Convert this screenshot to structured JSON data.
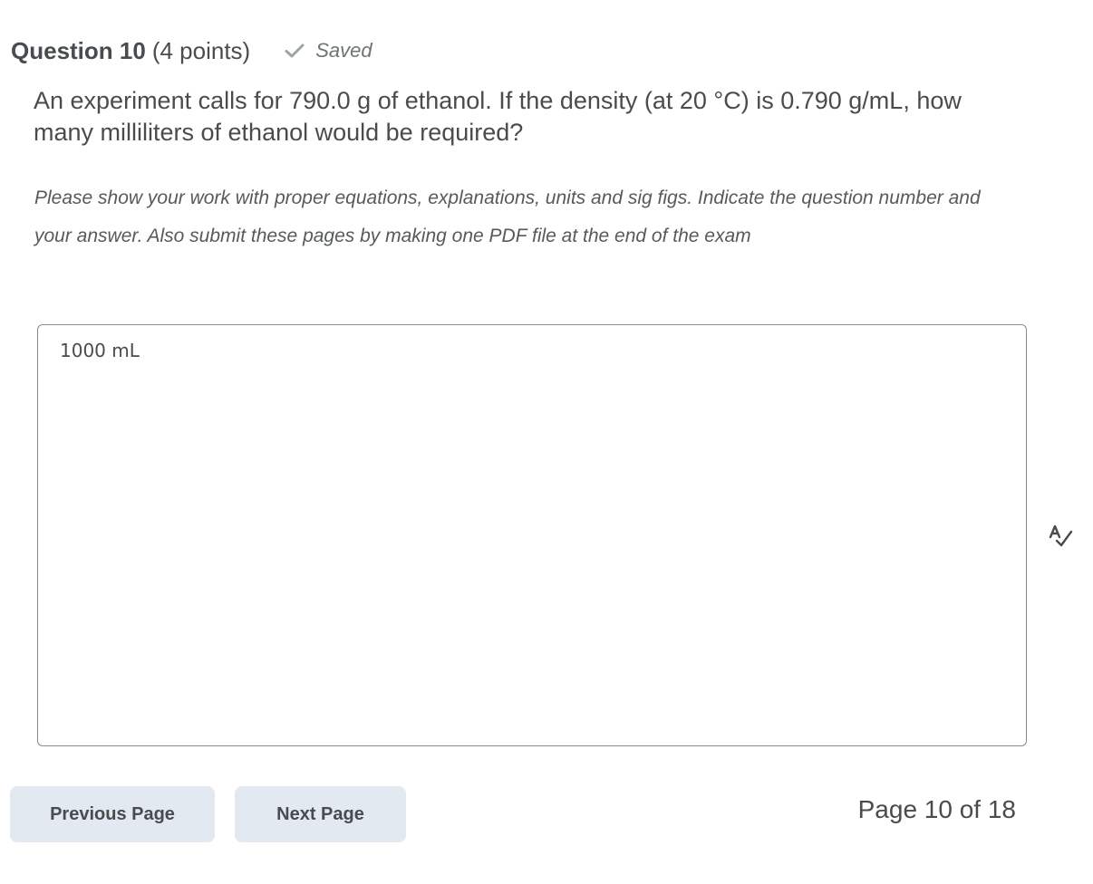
{
  "question": {
    "title": "Question 10",
    "points": "(4 points)",
    "status": "Saved",
    "status_icon": "checkmark-icon",
    "text": "An experiment calls for 790.0 g of ethanol.  If the density (at 20 °C) is 0.790 g/mL, how many milliliters of ethanol would be required?",
    "instructions": "Please show your work with proper equations, explanations, units and sig figs. Indicate the question number and your answer. Also submit these pages by making one PDF file at the end of the exam"
  },
  "answer": {
    "value": "1000 mL"
  },
  "spellcheck_icon": "spellcheck-icon",
  "navigation": {
    "previous_label": "Previous Page",
    "next_label": "Next Page",
    "page_indicator": "Page 10 of 18"
  },
  "colors": {
    "text": "#494c4e",
    "button_bg": "#e3e9f1",
    "border": "#868c8f"
  }
}
